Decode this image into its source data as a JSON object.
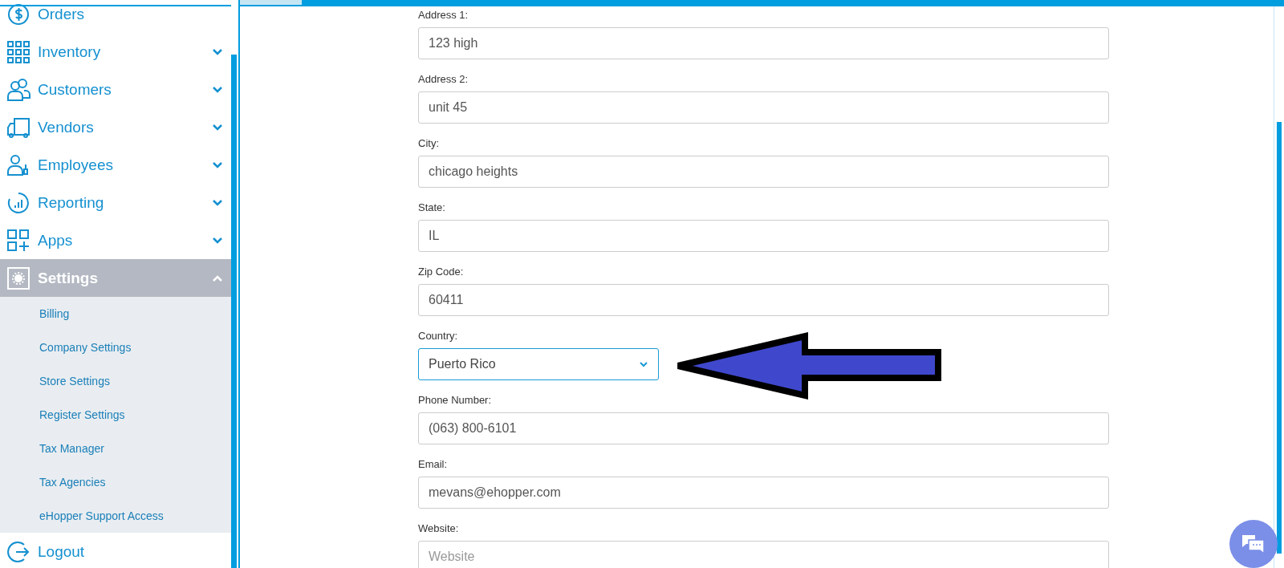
{
  "sidebar": {
    "items": [
      {
        "label": "Orders",
        "kind": "link",
        "selected": false
      },
      {
        "label": "Inventory",
        "kind": "group",
        "expanded": false,
        "selected": false
      },
      {
        "label": "Customers",
        "kind": "group",
        "expanded": false,
        "selected": false
      },
      {
        "label": "Vendors",
        "kind": "group",
        "expanded": false,
        "selected": false
      },
      {
        "label": "Employees",
        "kind": "group",
        "expanded": false,
        "selected": false
      },
      {
        "label": "Reporting",
        "kind": "group",
        "expanded": false,
        "selected": false
      },
      {
        "label": "Apps",
        "kind": "group",
        "expanded": false,
        "selected": false
      },
      {
        "label": "Settings",
        "kind": "group",
        "expanded": true,
        "selected": true,
        "children": [
          {
            "label": "Billing"
          },
          {
            "label": "Company Settings"
          },
          {
            "label": "Store Settings"
          },
          {
            "label": "Register Settings"
          },
          {
            "label": "Tax Manager"
          },
          {
            "label": "Tax Agencies"
          },
          {
            "label": "eHopper Support Access"
          }
        ]
      },
      {
        "label": "Logout",
        "kind": "link",
        "selected": false
      }
    ]
  },
  "form": {
    "fields": [
      {
        "label": "Address 1:",
        "kind": "text",
        "value": "123 high",
        "focused": false
      },
      {
        "label": "Address 2:",
        "kind": "text",
        "value": "unit 45",
        "focused": false
      },
      {
        "label": "City:",
        "kind": "text",
        "value": "chicago heights",
        "focused": false
      },
      {
        "label": "State:",
        "kind": "text",
        "value": "IL",
        "focused": false
      },
      {
        "label": "Zip Code:",
        "kind": "text",
        "value": "60411",
        "focused": false
      },
      {
        "label": "Country:",
        "kind": "select",
        "value": "Puerto Rico",
        "focused": true,
        "annotated": true
      },
      {
        "label": "Phone Number:",
        "kind": "text",
        "value": "(063) 800-6101",
        "focused": false
      },
      {
        "label": "Email:",
        "kind": "text",
        "value": "mevans@ehopper.com",
        "focused": false
      },
      {
        "label": "Website:",
        "kind": "text",
        "placeholder": "Website",
        "focused": false
      }
    ]
  }
}
